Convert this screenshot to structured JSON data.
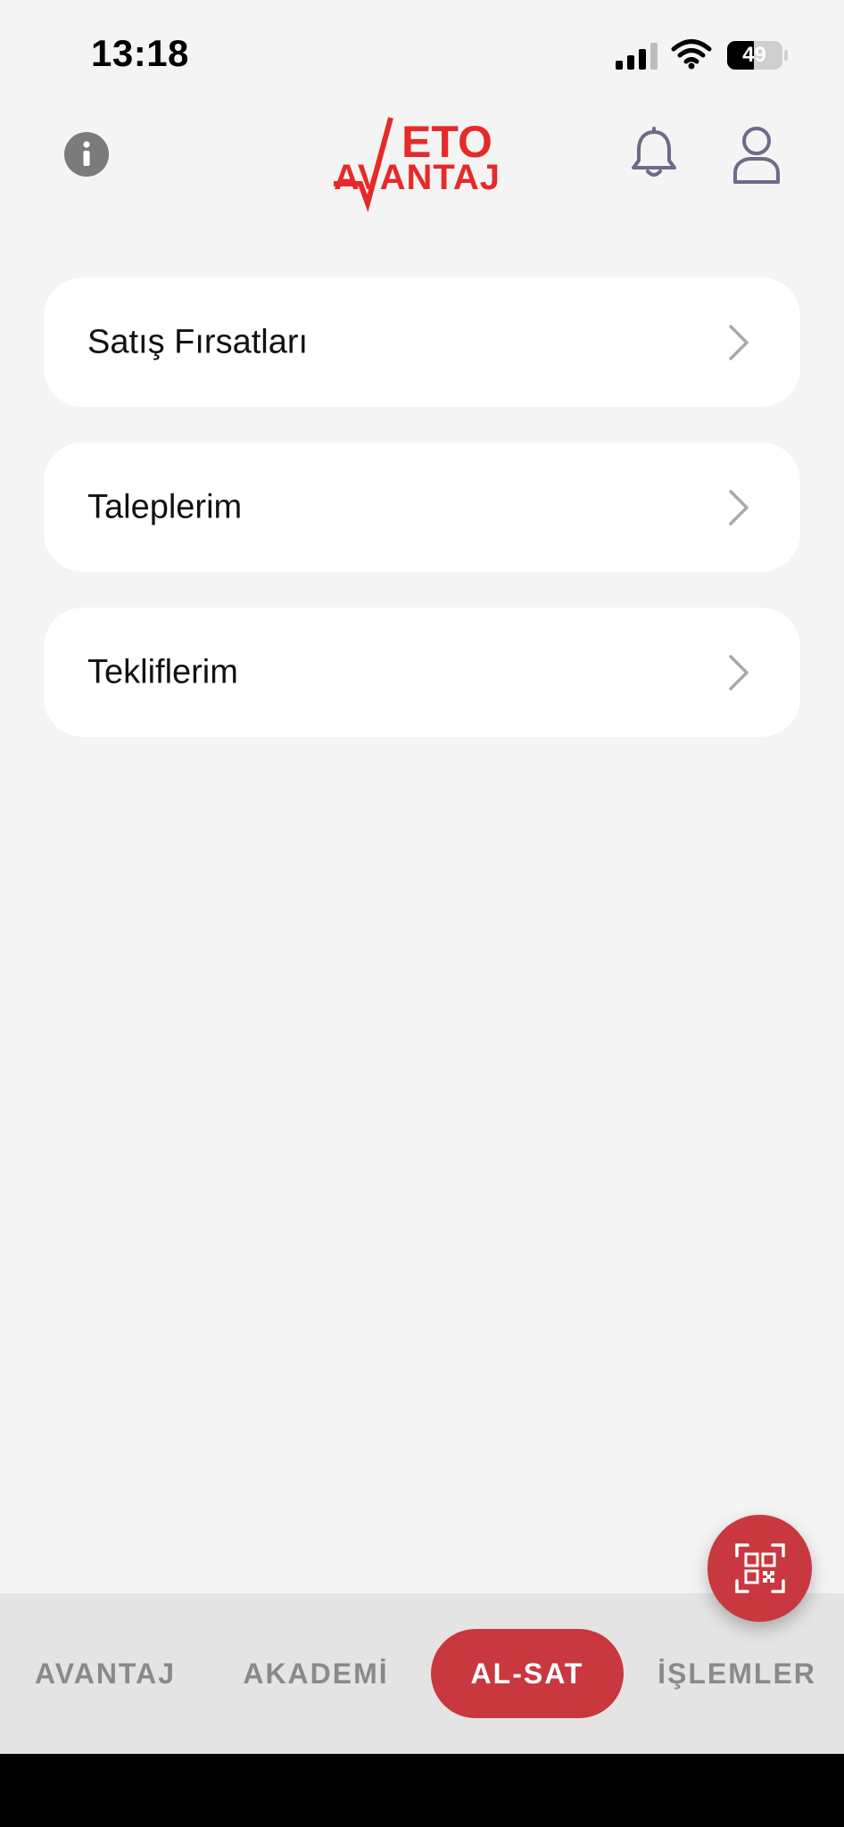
{
  "status_bar": {
    "time": "13:18",
    "battery": "49",
    "icons": [
      "cellular-signal-icon",
      "wifi-icon",
      "battery-icon"
    ]
  },
  "header": {
    "logo_line1": "ETO",
    "logo_line2": "AVANTAJ",
    "icons": [
      "info-icon",
      "bell-icon",
      "user-icon"
    ]
  },
  "menu": {
    "items": [
      {
        "label": "Satış Fırsatları"
      },
      {
        "label": "Taleplerim"
      },
      {
        "label": "Tekliflerim"
      }
    ]
  },
  "fab": {
    "icon": "qr-scan-icon"
  },
  "tabs": [
    {
      "label": "AVANTAJ",
      "active": false
    },
    {
      "label": "AKADEMİ",
      "active": false
    },
    {
      "label": "AL-SAT",
      "active": true
    },
    {
      "label": "İŞLEMLER",
      "active": false
    }
  ],
  "colors": {
    "brand_red": "#e52a2a",
    "accent_red": "#c9383f",
    "background": "#f4f4f4",
    "tab_bar": "#e4e4e4"
  }
}
